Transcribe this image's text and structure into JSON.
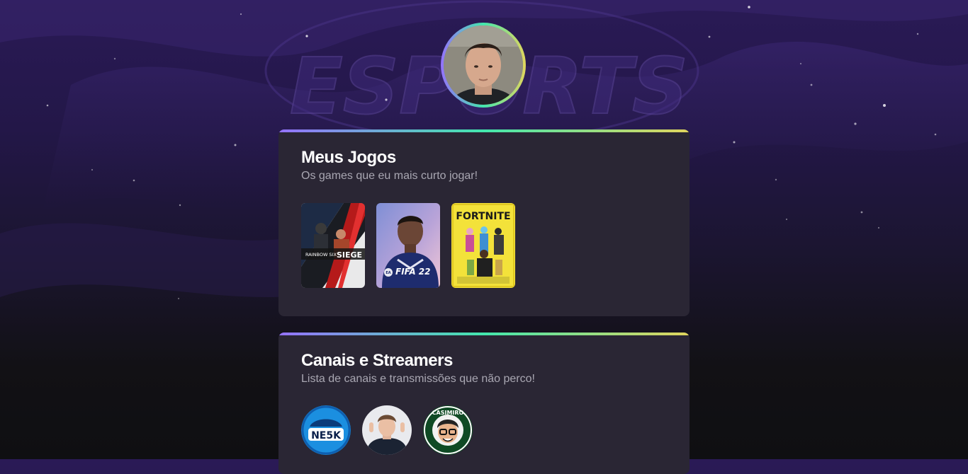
{
  "profile": {
    "avatar_icon": "person-photo"
  },
  "background": {
    "watermark_text": "ESPORTS"
  },
  "games_section": {
    "title": "Meus Jogos",
    "subtitle": "Os games que eu mais curto jogar!",
    "games": [
      {
        "name": "Rainbow Six Siege",
        "logo_top": "RAINBOW SIX",
        "logo_main": "SIEGE"
      },
      {
        "name": "FIFA 22",
        "logo_main": "FIFA 22",
        "badge": "EA"
      },
      {
        "name": "Fortnite",
        "logo_main": "FORTNITE"
      }
    ]
  },
  "channels_section": {
    "title": "Canais e Streamers",
    "subtitle": "Lista de canais e transmissões que não perco!",
    "channels": [
      {
        "logo_text": "NE5K"
      },
      {
        "icon": "streamer-avatar"
      },
      {
        "logo_text": "CASIMIRO"
      }
    ]
  },
  "colors": {
    "gradient_start": "#9572fc",
    "gradient_mid": "#43e7ad",
    "gradient_end": "#e1d55d",
    "card_bg": "#2a2634",
    "subtitle_text": "#a9a7b2"
  }
}
